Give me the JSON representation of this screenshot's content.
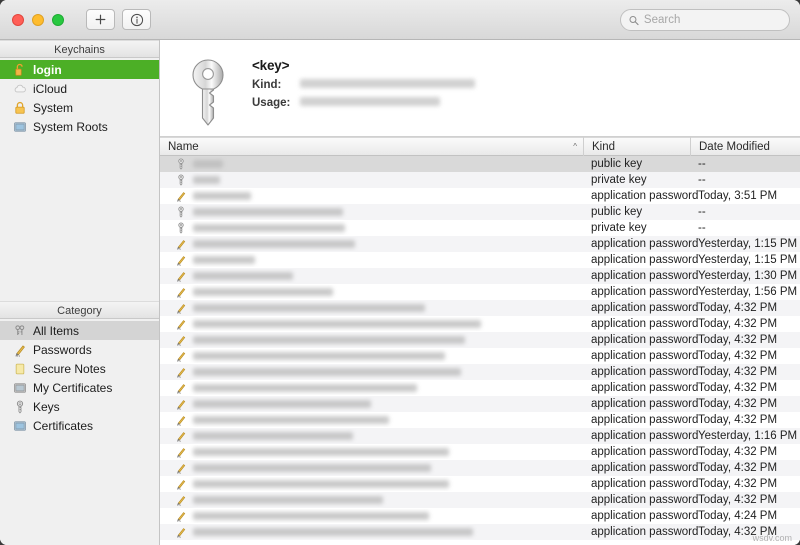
{
  "window": {
    "traffic_lights": [
      "close",
      "minimize",
      "zoom"
    ],
    "colors": {
      "accent_green": "#4caf26",
      "close": "#ff5f57",
      "minimize": "#febc2e",
      "zoom": "#28c840"
    }
  },
  "toolbar": {
    "add_label": "+",
    "info_label": "i",
    "search": {
      "placeholder": "Search",
      "value": ""
    }
  },
  "sidebar": {
    "keychains_header": "Keychains",
    "keychains": [
      {
        "label": "login",
        "icon": "unlocked-keychain-icon",
        "selected": true
      },
      {
        "label": "iCloud",
        "icon": "cloud-icon",
        "selected": false
      },
      {
        "label": "System",
        "icon": "lock-icon",
        "selected": false
      },
      {
        "label": "System Roots",
        "icon": "certificate-icon",
        "selected": false
      }
    ],
    "category_header": "Category",
    "categories": [
      {
        "label": "All Items",
        "icon": "all-items-icon",
        "selected": true
      },
      {
        "label": "Passwords",
        "icon": "pencil-icon",
        "selected": false
      },
      {
        "label": "Secure Notes",
        "icon": "note-icon",
        "selected": false
      },
      {
        "label": "My Certificates",
        "icon": "my-certificate-icon",
        "selected": false
      },
      {
        "label": "Keys",
        "icon": "key-icon",
        "selected": false
      },
      {
        "label": "Certificates",
        "icon": "certificate-icon",
        "selected": false
      }
    ]
  },
  "detail": {
    "icon": "large-key-icon",
    "title": "<key>",
    "fields": [
      {
        "label": "Kind:",
        "value_redacted": true,
        "blur_width": 175
      },
      {
        "label": "Usage:",
        "value_redacted": true,
        "blur_width": 140
      }
    ]
  },
  "table": {
    "columns": [
      {
        "key": "name",
        "label": "Name",
        "sorted": true,
        "sort_dir": "asc"
      },
      {
        "key": "kind",
        "label": "Kind",
        "sorted": false
      },
      {
        "key": "date",
        "label": "Date Modified",
        "sorted": false
      }
    ],
    "rows": [
      {
        "icon": "key-icon",
        "name_redacted": true,
        "blur_width": 30,
        "kind": "public key",
        "date": "--",
        "selected": true
      },
      {
        "icon": "key-icon",
        "name_redacted": true,
        "blur_width": 27,
        "kind": "private key",
        "date": "--",
        "selected": false
      },
      {
        "icon": "pencil-icon",
        "name_redacted": true,
        "blur_width": 58,
        "kind": "application password",
        "date": "Today, 3:51 PM",
        "selected": false
      },
      {
        "icon": "key-icon",
        "name_redacted": true,
        "blur_width": 150,
        "kind": "public key",
        "date": "--",
        "selected": false
      },
      {
        "icon": "key-icon",
        "name_redacted": true,
        "blur_width": 152,
        "kind": "private key",
        "date": "--",
        "selected": false
      },
      {
        "icon": "pencil-icon",
        "name_redacted": true,
        "blur_width": 162,
        "kind": "application password",
        "date": "Yesterday, 1:15 PM",
        "selected": false
      },
      {
        "icon": "pencil-icon",
        "name_redacted": true,
        "blur_width": 62,
        "kind": "application password",
        "date": "Yesterday, 1:15 PM",
        "selected": false
      },
      {
        "icon": "pencil-icon",
        "name_redacted": true,
        "blur_width": 100,
        "kind": "application password",
        "date": "Yesterday, 1:30 PM",
        "selected": false
      },
      {
        "icon": "pencil-icon",
        "name_redacted": true,
        "blur_width": 140,
        "kind": "application password",
        "date": "Yesterday, 1:56 PM",
        "selected": false
      },
      {
        "icon": "pencil-icon",
        "name_redacted": true,
        "blur_width": 232,
        "kind": "application password",
        "date": "Today, 4:32 PM",
        "selected": false
      },
      {
        "icon": "pencil-icon",
        "name_redacted": true,
        "blur_width": 288,
        "kind": "application password",
        "date": "Today, 4:32 PM",
        "selected": false
      },
      {
        "icon": "pencil-icon",
        "name_redacted": true,
        "blur_width": 272,
        "kind": "application password",
        "date": "Today, 4:32 PM",
        "selected": false
      },
      {
        "icon": "pencil-icon",
        "name_redacted": true,
        "blur_width": 252,
        "kind": "application password",
        "date": "Today, 4:32 PM",
        "selected": false
      },
      {
        "icon": "pencil-icon",
        "name_redacted": true,
        "blur_width": 268,
        "kind": "application password",
        "date": "Today, 4:32 PM",
        "selected": false
      },
      {
        "icon": "pencil-icon",
        "name_redacted": true,
        "blur_width": 224,
        "kind": "application password",
        "date": "Today, 4:32 PM",
        "selected": false
      },
      {
        "icon": "pencil-icon",
        "name_redacted": true,
        "blur_width": 178,
        "kind": "application password",
        "date": "Today, 4:32 PM",
        "selected": false
      },
      {
        "icon": "pencil-icon",
        "name_redacted": true,
        "blur_width": 196,
        "kind": "application password",
        "date": "Today, 4:32 PM",
        "selected": false
      },
      {
        "icon": "pencil-icon",
        "name_redacted": true,
        "blur_width": 160,
        "kind": "application password",
        "date": "Yesterday, 1:16 PM",
        "selected": false
      },
      {
        "icon": "pencil-icon",
        "name_redacted": true,
        "blur_width": 256,
        "kind": "application password",
        "date": "Today, 4:32 PM",
        "selected": false
      },
      {
        "icon": "pencil-icon",
        "name_redacted": true,
        "blur_width": 238,
        "kind": "application password",
        "date": "Today, 4:32 PM",
        "selected": false
      },
      {
        "icon": "pencil-icon",
        "name_redacted": true,
        "blur_width": 256,
        "kind": "application password",
        "date": "Today, 4:32 PM",
        "selected": false
      },
      {
        "icon": "pencil-icon",
        "name_redacted": true,
        "blur_width": 190,
        "kind": "application password",
        "date": "Today, 4:32 PM",
        "selected": false
      },
      {
        "icon": "pencil-icon",
        "name_redacted": true,
        "blur_width": 236,
        "kind": "application password",
        "date": "Today, 4:24 PM",
        "selected": false
      },
      {
        "icon": "pencil-icon",
        "name_redacted": true,
        "blur_width": 280,
        "kind": "application password",
        "date": "Today, 4:32 PM",
        "selected": false
      }
    ]
  },
  "watermark": {
    "text": "wsdv.com"
  }
}
